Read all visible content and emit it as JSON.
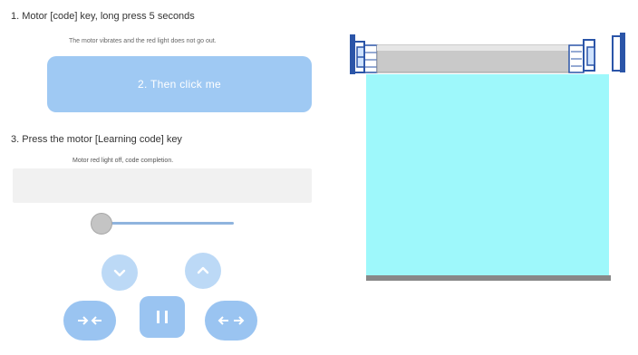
{
  "steps": {
    "step1_heading": "1. Motor [code] key, long press 5 seconds",
    "step1_description": "The motor vibrates and the red light does not go out.",
    "step2_button_label": "2. Then click me",
    "step3_heading": "3. Press the motor [Learning code] key",
    "step3_description": "Motor red light off, code completion."
  },
  "slider": {
    "value": 0
  },
  "controls": {
    "down_icon": "chevron-down-icon",
    "up_icon": "chevron-up-icon",
    "close_icon": "arrows-inward-icon",
    "pause_icon": "pause-icon",
    "open_icon": "arrows-outward-icon"
  },
  "curtain": {
    "fabric_color": "#9ef8fb",
    "rail_color": "#888888"
  },
  "colors": {
    "accent_light": "#bcd9f6",
    "accent": "#9ac4f1",
    "button_primary": "#9fc9f3"
  }
}
